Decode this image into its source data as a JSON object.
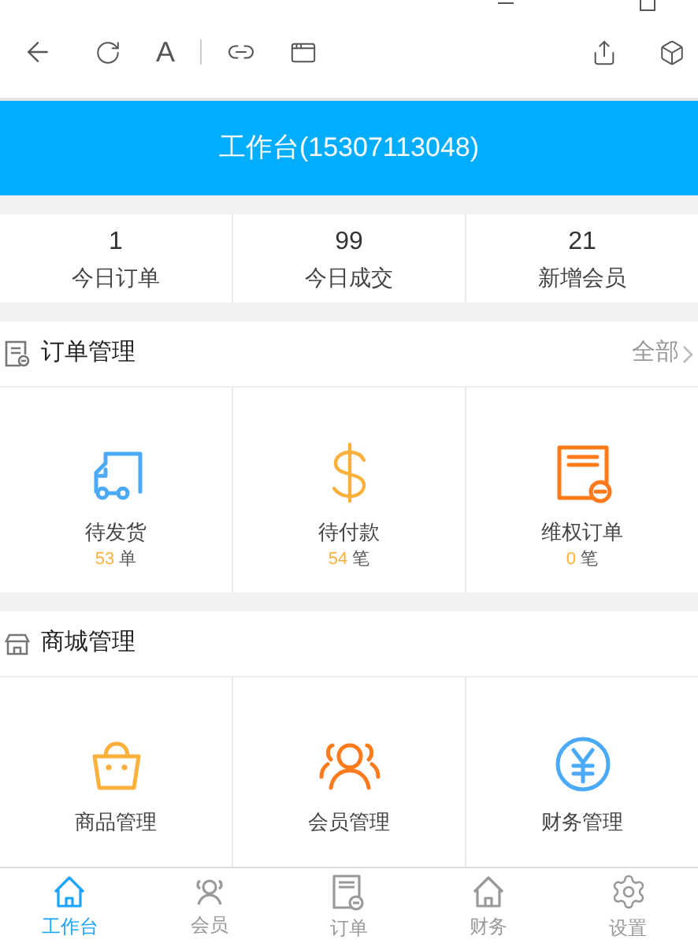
{
  "browser": {
    "font_button": "A"
  },
  "header": {
    "title": "工作台(15307113048)"
  },
  "stats": [
    {
      "value": "1",
      "label": "今日订单"
    },
    {
      "value": "99",
      "label": "今日成交"
    },
    {
      "value": "21",
      "label": "新增会员"
    }
  ],
  "sections": [
    {
      "kind": "orders",
      "title": "订单管理",
      "more": "全部",
      "items": [
        {
          "kind": "truck",
          "color": "#4aaaf8",
          "label": "待发货",
          "count": "53",
          "unit": "单"
        },
        {
          "kind": "dollar",
          "color": "#fbb03b",
          "label": "待付款",
          "count": "54",
          "unit": "笔"
        },
        {
          "kind": "refund",
          "color": "#ff7a1a",
          "label": "维权订单",
          "count": "0",
          "unit": "笔"
        }
      ]
    },
    {
      "kind": "shop",
      "title": "商城管理",
      "items": [
        {
          "kind": "bag",
          "color": "#fbb03b",
          "label": "商品管理"
        },
        {
          "kind": "people",
          "color": "#ff7a1a",
          "label": "会员管理"
        },
        {
          "kind": "yen",
          "color": "#4aaaf8",
          "label": "财务管理"
        }
      ]
    }
  ],
  "tabbar": [
    {
      "kind": "home",
      "label": "工作台",
      "selected": true
    },
    {
      "kind": "people",
      "label": "会员",
      "selected": false
    },
    {
      "kind": "order",
      "label": "订单",
      "selected": false
    },
    {
      "kind": "home",
      "label": "财务",
      "selected": false
    },
    {
      "kind": "gear",
      "label": "设置",
      "selected": false
    }
  ]
}
